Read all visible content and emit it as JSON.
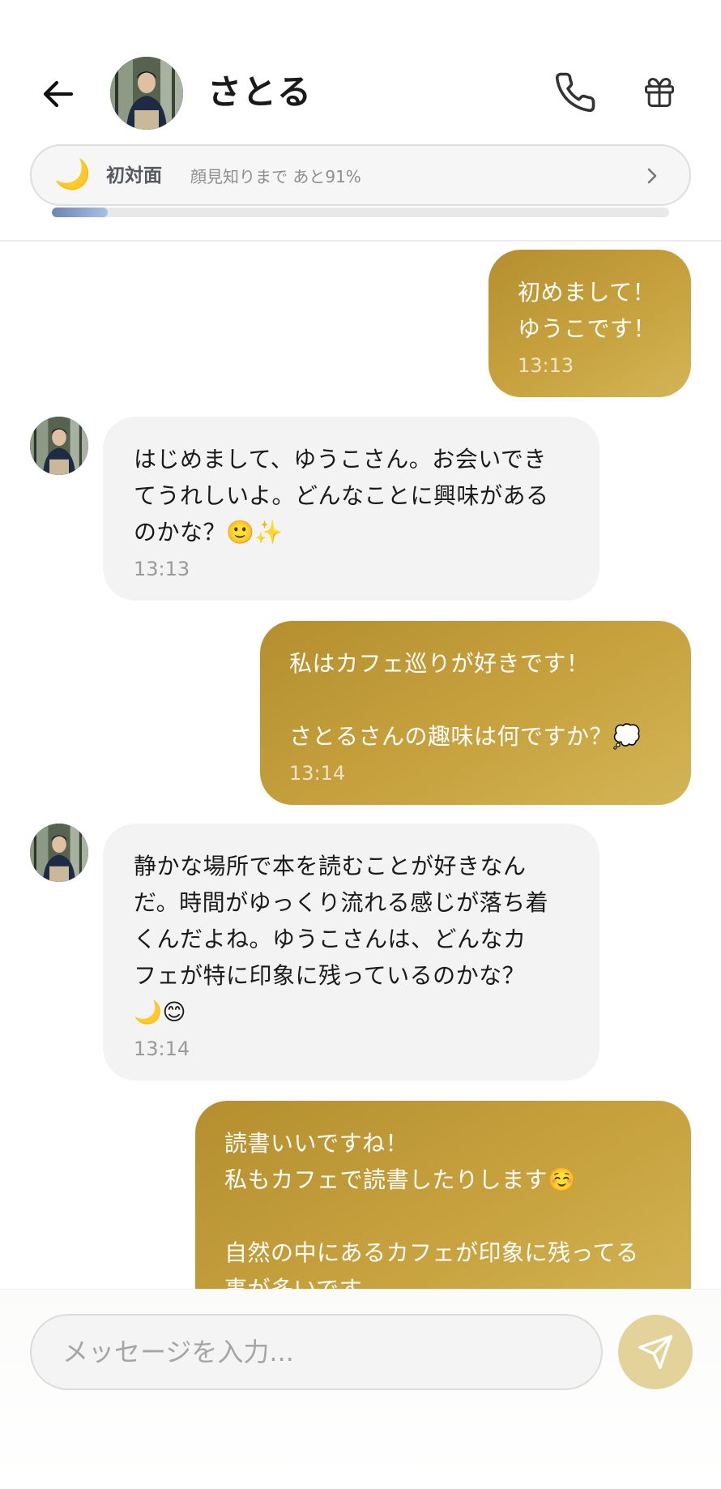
{
  "header": {
    "back_icon": "arrow-left-icon",
    "contact_name": "さとる",
    "call_icon": "phone-icon",
    "gift_icon": "gift-icon"
  },
  "relationship": {
    "icon": "🌙",
    "level_name": "初対面",
    "progress_text": "顔見知りまで あと91%",
    "progress_fraction": 0.09,
    "chevron_icon": "chevron-right-icon"
  },
  "messages": [
    {
      "from": "me",
      "text": "初めまして！\nゆうこです！",
      "time": "13:13"
    },
    {
      "from": "contact",
      "text": "はじめまして、ゆうこさん。お会いでき\nてうれしいよ。どんなことに興味がある\nのかな？🙂✨",
      "time": "13:13"
    },
    {
      "from": "me",
      "text": "私はカフェ巡りが好きです！\n\nさとるさんの趣味は何ですか？💭",
      "time": "13:14"
    },
    {
      "from": "contact",
      "text": "静かな場所で本を読むことが好きなん\nだ。時間がゆっくり流れる感じが落ち着\nくんだよね。ゆうこさんは、どんなカ\nフェが特に印象に残っているのかな？\n🌙😊",
      "time": "13:14"
    },
    {
      "from": "me",
      "text": "読書いいですね！\n私もカフェで読書したりします☺️\n\n自然の中にあるカフェが印象に残ってる\n事が多いです。",
      "time": ""
    }
  ],
  "composer": {
    "placeholder": "メッセージを入力...",
    "value": "",
    "send_icon": "send-icon"
  },
  "colors": {
    "outgoing_bubble": "#c19b3a",
    "incoming_bubble": "#f3f3f3",
    "send_button": "#e3d29a",
    "progress_fill": "#8aa3cc"
  }
}
